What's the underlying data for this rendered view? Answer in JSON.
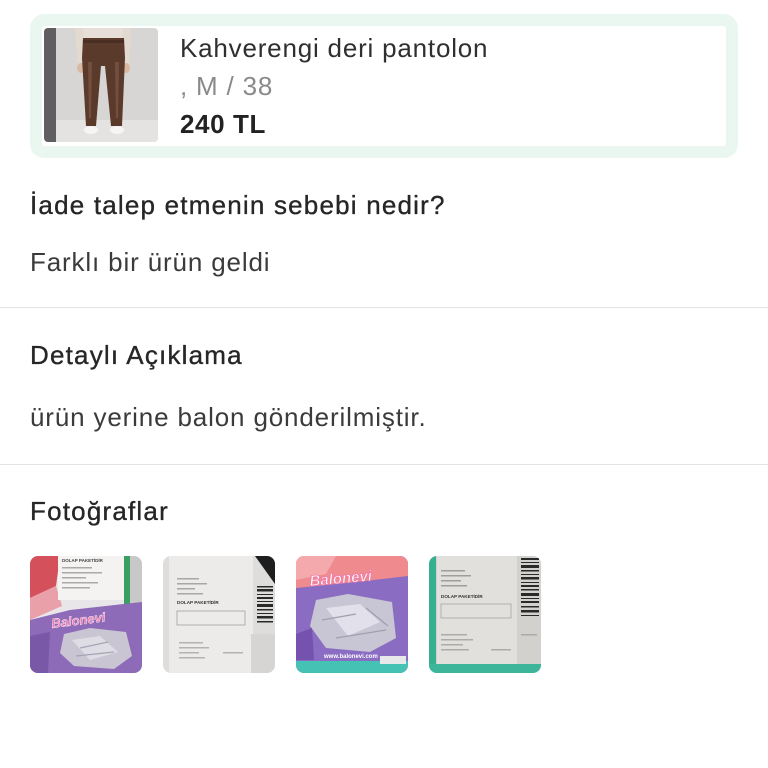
{
  "product": {
    "name": "Kahverengi deri pantolon",
    "variant": ", M / 38",
    "price": "240 TL"
  },
  "reason": {
    "question": "İade talep etmenin sebebi nedir?",
    "answer": "Farklı bir ürün geldi"
  },
  "description": {
    "title": "Detaylı Açıklama",
    "text": "ürün yerine balon gönderilmiştir."
  },
  "photos": {
    "title": "Fotoğraflar",
    "lettering": {
      "logo": "Balonevi",
      "package_label": "DOLAP PAKETİDİR",
      "website": "www.balonevi.com"
    }
  },
  "colors": {
    "card_border": "#eaf7f1",
    "divider": "#e3e3e3",
    "primary_text": "#333333",
    "secondary_text": "#8a8a8a"
  }
}
